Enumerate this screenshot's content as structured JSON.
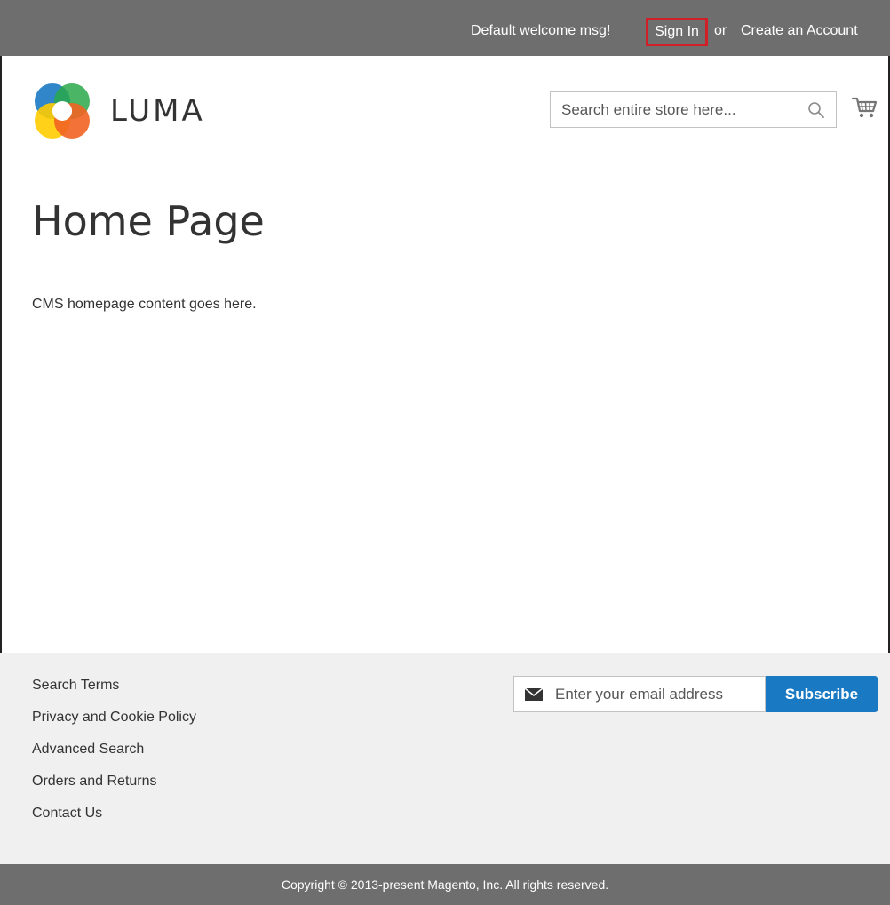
{
  "header": {
    "welcome": "Default welcome msg!",
    "sign_in": "Sign In",
    "or": "or",
    "create_account": "Create an Account"
  },
  "brand": {
    "name": "LUMA",
    "logo_colors": [
      "#f26322",
      "#ffcc00",
      "#1979c3",
      "#29a84a"
    ]
  },
  "search": {
    "placeholder": "Search entire store here..."
  },
  "main": {
    "title": "Home Page",
    "content": "CMS homepage content goes here."
  },
  "footer": {
    "links": [
      "Search Terms",
      "Privacy and Cookie Policy",
      "Advanced Search",
      "Orders and Returns",
      "Contact Us"
    ],
    "newsletter": {
      "placeholder": "Enter your email address",
      "button": "Subscribe"
    },
    "copyright": "Copyright © 2013-present Magento, Inc. All rights reserved."
  },
  "colors": {
    "topbar": "#6e6e6e",
    "accent": "#1979c3",
    "highlight": "#d01f27",
    "footer_bg": "#f0f0f0"
  },
  "icons": {
    "logo": "luma-logo-icon",
    "search": "search-icon",
    "cart": "cart-icon",
    "envelope": "envelope-icon"
  }
}
